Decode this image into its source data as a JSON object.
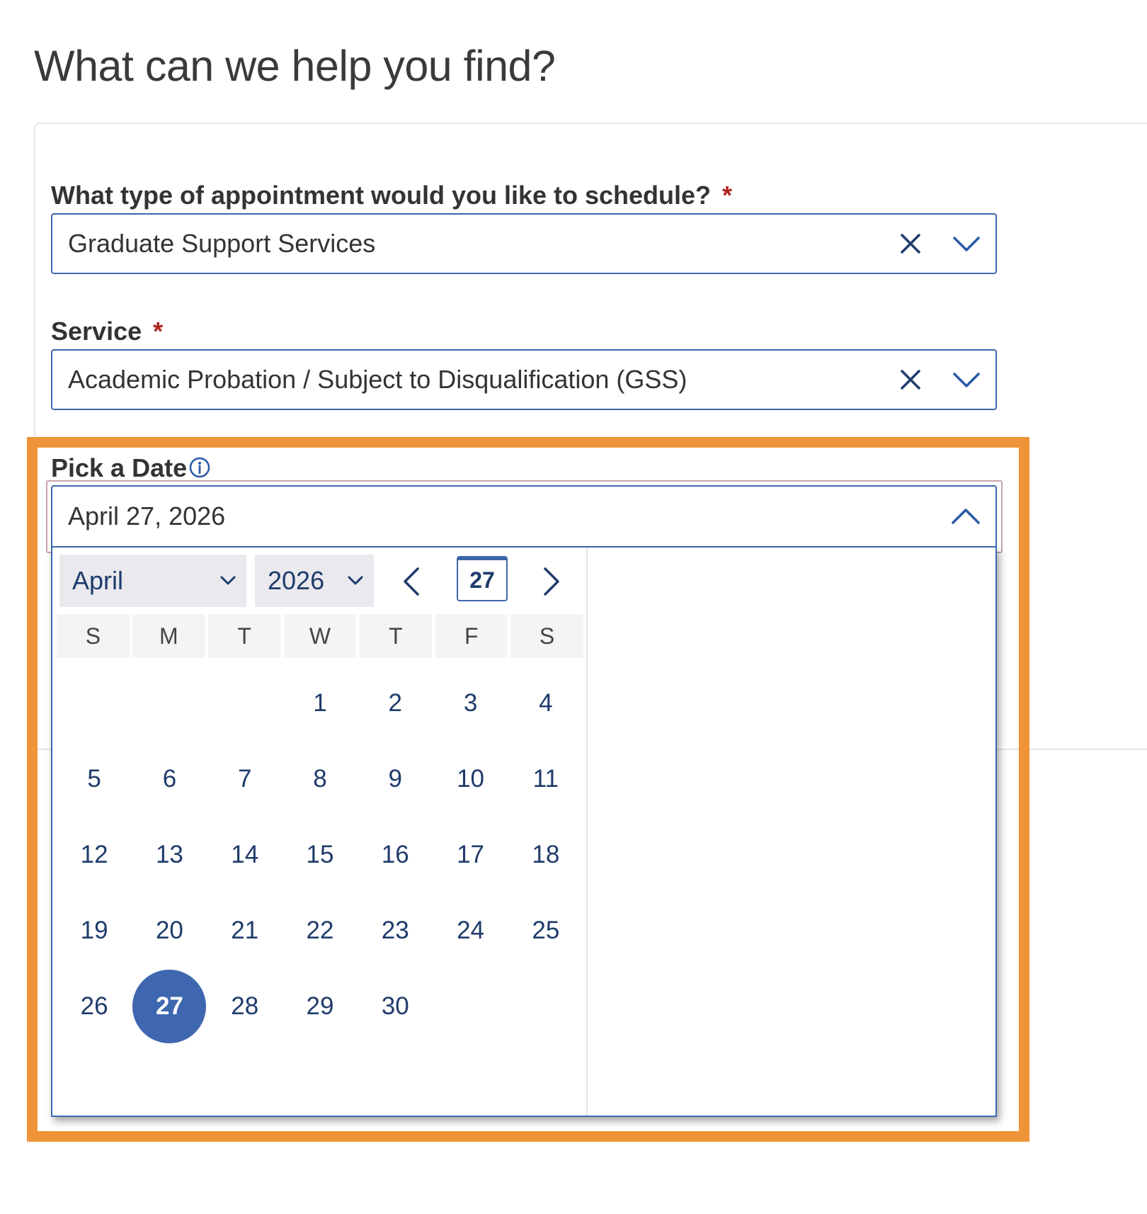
{
  "page": {
    "title": "What can we help you find?"
  },
  "appointment_type": {
    "label": "What type of appointment would you like to schedule?",
    "required_mark": "*",
    "value": "Graduate Support Services"
  },
  "service": {
    "label": "Service",
    "required_mark": "*",
    "value": "Academic Probation / Subject to Disqualification (GSS)"
  },
  "date_picker": {
    "label": "Pick a Date",
    "value": "April 27, 2026",
    "month": "April",
    "year": "2026",
    "today_label": "27",
    "weekdays": [
      "S",
      "M",
      "T",
      "W",
      "T",
      "F",
      "S"
    ],
    "weeks": [
      [
        "",
        "",
        "",
        "1",
        "2",
        "3",
        "4"
      ],
      [
        "5",
        "6",
        "7",
        "8",
        "9",
        "10",
        "11"
      ],
      [
        "12",
        "13",
        "14",
        "15",
        "16",
        "17",
        "18"
      ],
      [
        "19",
        "20",
        "21",
        "22",
        "23",
        "24",
        "25"
      ],
      [
        "26",
        "27",
        "28",
        "29",
        "30",
        "",
        ""
      ]
    ],
    "selected_day": "27"
  },
  "colors": {
    "accent": "#3e68ad",
    "selected_day": "#3f67b0",
    "highlight_frame": "#ef9438",
    "required": "#b0221c"
  },
  "icons": {
    "clear": "close-icon",
    "dropdown": "chevron-down-icon",
    "collapse": "chevron-up-icon",
    "info": "info-icon",
    "prev": "chevron-left-icon",
    "next": "chevron-right-icon"
  }
}
